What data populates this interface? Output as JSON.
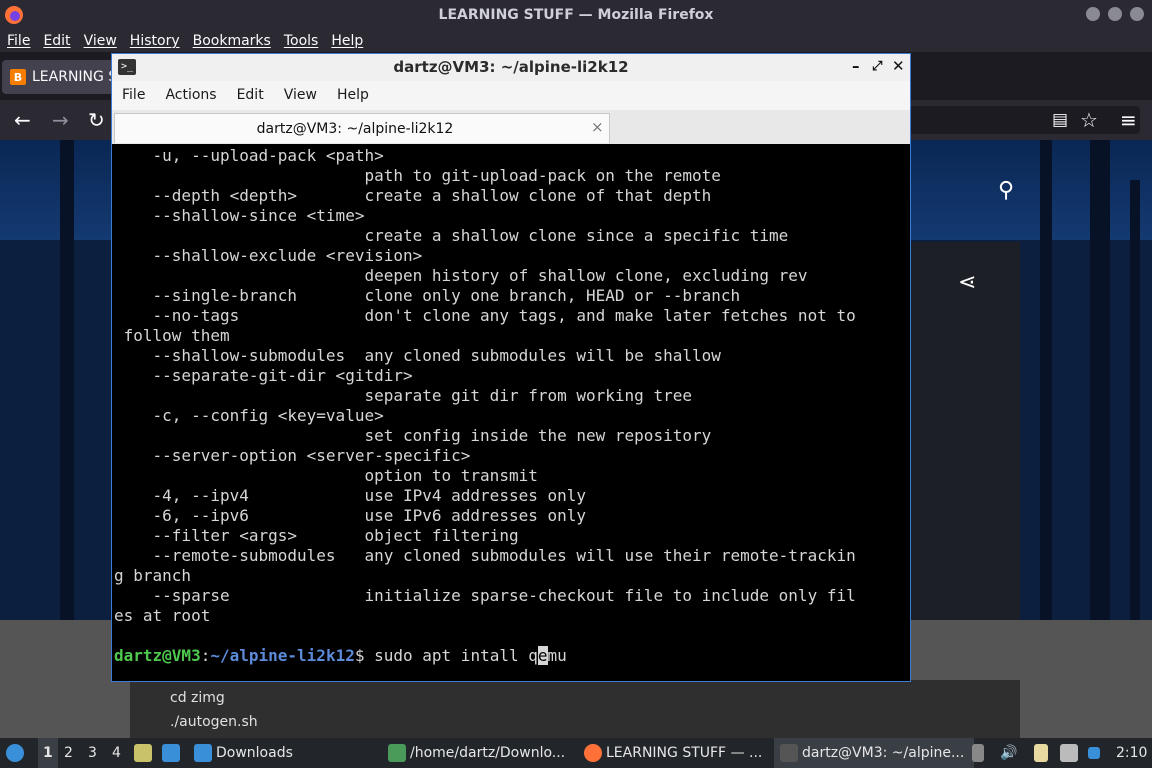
{
  "firefox": {
    "window_title": "LEARNING STUFF — Mozilla Firefox",
    "menu": [
      "File",
      "Edit",
      "View",
      "History",
      "Bookmarks",
      "Tools",
      "Help"
    ],
    "tab_label": "LEARNING S"
  },
  "page": {
    "code_lines": [
      "cd zimg",
      "./autogen.sh"
    ]
  },
  "terminal": {
    "title": "dartz@VM3: ~/alpine-li2k12",
    "menu": [
      "File",
      "Actions",
      "Edit",
      "View",
      "Help"
    ],
    "tab_label": "dartz@VM3: ~/alpine-li2k12",
    "tab_close": "×",
    "lines": [
      "    -u, --upload-pack <path>",
      "                          path to git-upload-pack on the remote",
      "    --depth <depth>       create a shallow clone of that depth",
      "    --shallow-since <time>",
      "                          create a shallow clone since a specific time",
      "    --shallow-exclude <revision>",
      "                          deepen history of shallow clone, excluding rev",
      "    --single-branch       clone only one branch, HEAD or --branch",
      "    --no-tags             don't clone any tags, and make later fetches not to",
      " follow them",
      "    --shallow-submodules  any cloned submodules will be shallow",
      "    --separate-git-dir <gitdir>",
      "                          separate git dir from working tree",
      "    -c, --config <key=value>",
      "                          set config inside the new repository",
      "    --server-option <server-specific>",
      "                          option to transmit",
      "    -4, --ipv4            use IPv4 addresses only",
      "    -6, --ipv6            use IPv6 addresses only",
      "    --filter <args>       object filtering",
      "    --remote-submodules   any cloned submodules will use their remote-trackin",
      "g branch",
      "    --sparse              initialize sparse-checkout file to include only fil",
      "es at root",
      ""
    ],
    "prompt_user": "dartz@VM3",
    "prompt_sep": ":",
    "prompt_path": "~/alpine-li2k12",
    "prompt_dollar": "$ ",
    "command_before_cursor": "sudo apt intall q",
    "cursor_char": "e",
    "command_after_cursor": "mu"
  },
  "taskbar": {
    "workspaces": [
      "1",
      "2",
      "3",
      "4"
    ],
    "downloads_label": "Downloads",
    "items": [
      "/home/dartz/Downlo...",
      "LEARNING STUFF — ...",
      "dartz@VM3: ~/alpine..."
    ],
    "clock": "2:10"
  },
  "colors": {
    "terminal_border": "#3a7bd5",
    "prompt_user": "#4ec94e",
    "prompt_path": "#5b8bd9"
  }
}
